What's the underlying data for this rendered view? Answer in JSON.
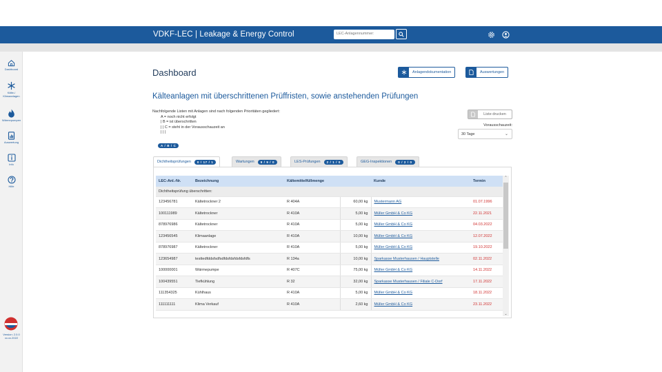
{
  "header": {
    "title": "VDKF-LEC | Leakage & Energy Control",
    "search_placeholder": "LEC-Anlagennummer:"
  },
  "sidebar": {
    "items": [
      {
        "label": "Dashboard",
        "icon": "home-icon"
      },
      {
        "label": "Kälte-/ Klimaanlagen",
        "icon": "snowflake-icon"
      },
      {
        "label": "Wärmepumpen",
        "icon": "flame-icon"
      },
      {
        "label": "Auswertung",
        "icon": "report-icon"
      },
      {
        "label": "Info",
        "icon": "info-icon"
      },
      {
        "label": "Hilfe",
        "icon": "help-icon"
      }
    ],
    "version_line1": "Version: 2.0.0",
    "version_line2": "xx.xx.2022"
  },
  "page": {
    "title": "Dashboard",
    "btn_anlagendoku": "Anlagendokumentation",
    "btn_auswertungen": "Auswertungen",
    "section_title": "Kälteanlagen mit überschrittenen Prüffristen, sowie anstehenden Prüfungen",
    "legend": {
      "intro": "Nachfolgende Listen mit Anlagen sind nach folgenden Prioritäten gegliedert:",
      "a": "A = noch nicht erfolgt",
      "b": "|    B = ist überschritten",
      "c": "|    |    C = steht in der Vorausschauzeit an",
      "bars": "|    |    |",
      "pill": "A / B / C"
    },
    "print_label": "Liste drucken",
    "vorausschau_label": "Vorausschauzeit:",
    "vorausschau_value": "30 Tage"
  },
  "tabs": [
    {
      "label": "Dichtheitsprüfungen",
      "count": "0 / 17 / 1",
      "active": true
    },
    {
      "label": "Wartungen",
      "count": "9 / 9 / 0",
      "active": false
    },
    {
      "label": "LES-Prüfungen",
      "count": "2 / 1 / 0",
      "active": false
    },
    {
      "label": "GEG-Inspektionen",
      "count": "0 / 2 / 0",
      "active": false
    }
  ],
  "table": {
    "columns": [
      "LEC-Anl.-Nr.",
      "Bezeichnung",
      "Kältemittelfüllmenge",
      "",
      "Kunde",
      "Termin"
    ],
    "group_label": "Dichtheitsprüfung überschritten:",
    "rows": [
      {
        "nr": "123456781",
        "bez": "Kältetrockner 2",
        "km": "R 404A",
        "menge": "60,00 kg",
        "kunde": "Mustermann AG",
        "termin": "01.07.1996"
      },
      {
        "nr": "100111989",
        "bez": "Kältetrockner",
        "km": "R 410A",
        "menge": "5,00 kg",
        "kunde": "Müller GmbH & Co KG",
        "termin": "22.11.2021"
      },
      {
        "nr": "878976986",
        "bez": "Kältetrockner",
        "km": "R 410A",
        "menge": "5,00 kg",
        "kunde": "Müller GmbH & Co KG",
        "termin": "04.03.2022"
      },
      {
        "nr": "123456545",
        "bez": "Klimaanlage",
        "km": "R 410A",
        "menge": "10,00 kg",
        "kunde": "Müller GmbH & Co KG",
        "termin": "12.07.2022"
      },
      {
        "nr": "878976987",
        "bez": "Kältetrockner",
        "km": "R 410A",
        "menge": "5,00 kg",
        "kunde": "Müller GmbH & Co KG",
        "termin": "19.10.2022"
      },
      {
        "nr": "123654987",
        "bez": "testtedfddsfsdfsdfdsfdsfdsfdsfdfs",
        "km": "R 134a",
        "menge": "10,00 kg",
        "kunde": "Sparkasse Musterhausen / Hauptstelle",
        "termin": "02.11.2022"
      },
      {
        "nr": "100000001",
        "bez": "Wärmepumpe",
        "km": "R 407C",
        "menge": "75,00 kg",
        "kunde": "Müller GmbH & Co KG",
        "termin": "14.11.2022"
      },
      {
        "nr": "100439551",
        "bez": "Tiefkühlung",
        "km": "R 32",
        "menge": "32,00 kg",
        "kunde": "Sparkasse Musterhausen / Filiale C-Dorf",
        "termin": "17.11.2022"
      },
      {
        "nr": "111354325",
        "bez": "Kühlhaus",
        "km": "R 410A",
        "menge": "5,00 kg",
        "kunde": "Müller GmbH & Co KG",
        "termin": "18.11.2022"
      },
      {
        "nr": "111111111",
        "bez": "Klima Verkauf",
        "km": "R 410A",
        "menge": "2,60 kg",
        "kunde": "Müller GmbH & Co KG",
        "termin": "23.11.2022"
      }
    ]
  },
  "colors": {
    "brand": "#1c5a9c",
    "overdue": "#d0302f",
    "header_row": "#cfe0f5"
  }
}
